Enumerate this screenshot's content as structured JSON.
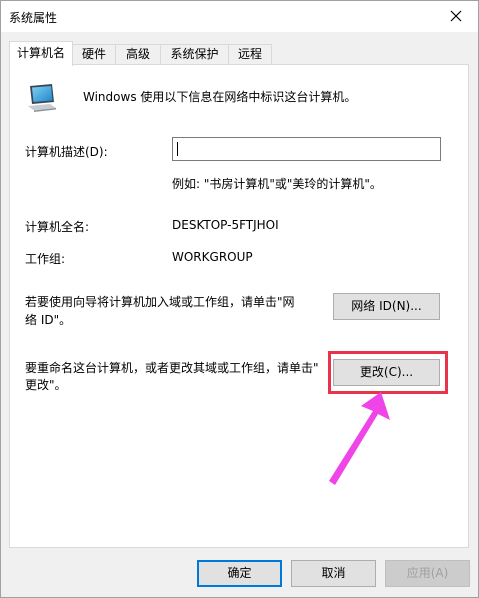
{
  "window": {
    "title": "系统属性"
  },
  "tabs": [
    {
      "label": "计算机名",
      "active": true
    },
    {
      "label": "硬件"
    },
    {
      "label": "高级"
    },
    {
      "label": "系统保护"
    },
    {
      "label": "远程"
    }
  ],
  "intro": {
    "text": "Windows 使用以下信息在网络中标识这台计算机。"
  },
  "description": {
    "label": "计算机描述(D):",
    "value": "",
    "example": "例如: \"书房计算机\"或\"美玲的计算机\"。"
  },
  "full_name": {
    "label": "计算机全名:",
    "value": "DESKTOP-5FTJHOI"
  },
  "workgroup": {
    "label": "工作组:",
    "value": "WORKGROUP"
  },
  "network_id": {
    "text_line1": "若要使用向导将计算机加入域或工作组，请单击\"网",
    "text_line2": "络 ID\"。",
    "button": "网络 ID(N)..."
  },
  "rename": {
    "text_line1": "要重命名这台计算机，或者更改其域或工作组，请单击\"",
    "text_line2": "更改\"。",
    "button": "更改(C)..."
  },
  "footer": {
    "ok": "确定",
    "cancel": "取消",
    "apply": "应用(A)"
  },
  "colors": {
    "highlight": "#e8344a",
    "arrow": "#ee44e8",
    "accent": "#0078d7"
  }
}
